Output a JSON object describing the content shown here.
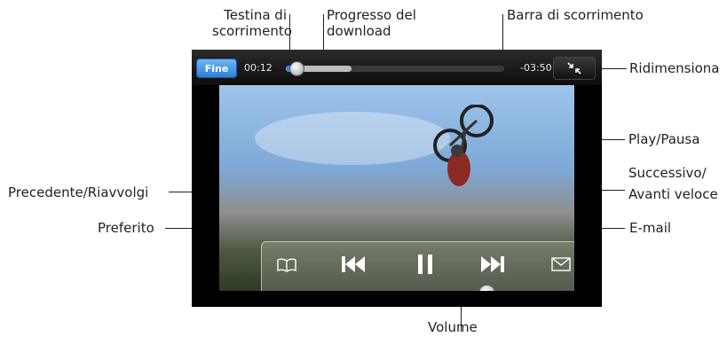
{
  "player": {
    "done_label": "Fine",
    "elapsed": "00:12",
    "remaining": "-03:50",
    "playback_progress": 0.05,
    "download_progress": 0.3,
    "volume_level": 0.78
  },
  "icons": {
    "resize": "resize-icon",
    "bookmark": "bookmark-icon",
    "previous": "previous-icon",
    "pause": "pause-icon",
    "next": "next-icon",
    "email": "email-icon"
  },
  "callouts": {
    "playhead": "Testina di scorrimento",
    "download_progress": "Progresso del download",
    "scrubber_bar": "Barra di scorrimento",
    "resize": "Ridimensiona",
    "play_pause": "Play/Pausa",
    "next_fast_forward": "Successivo/ Avanti veloce",
    "previous_rewind": "Precedente/Riavvolgi",
    "bookmark": "Preferito",
    "email": "E-mail",
    "volume": "Volume"
  },
  "colors": {
    "accent_blue": "#2e7fd8",
    "player_black": "#000000"
  }
}
